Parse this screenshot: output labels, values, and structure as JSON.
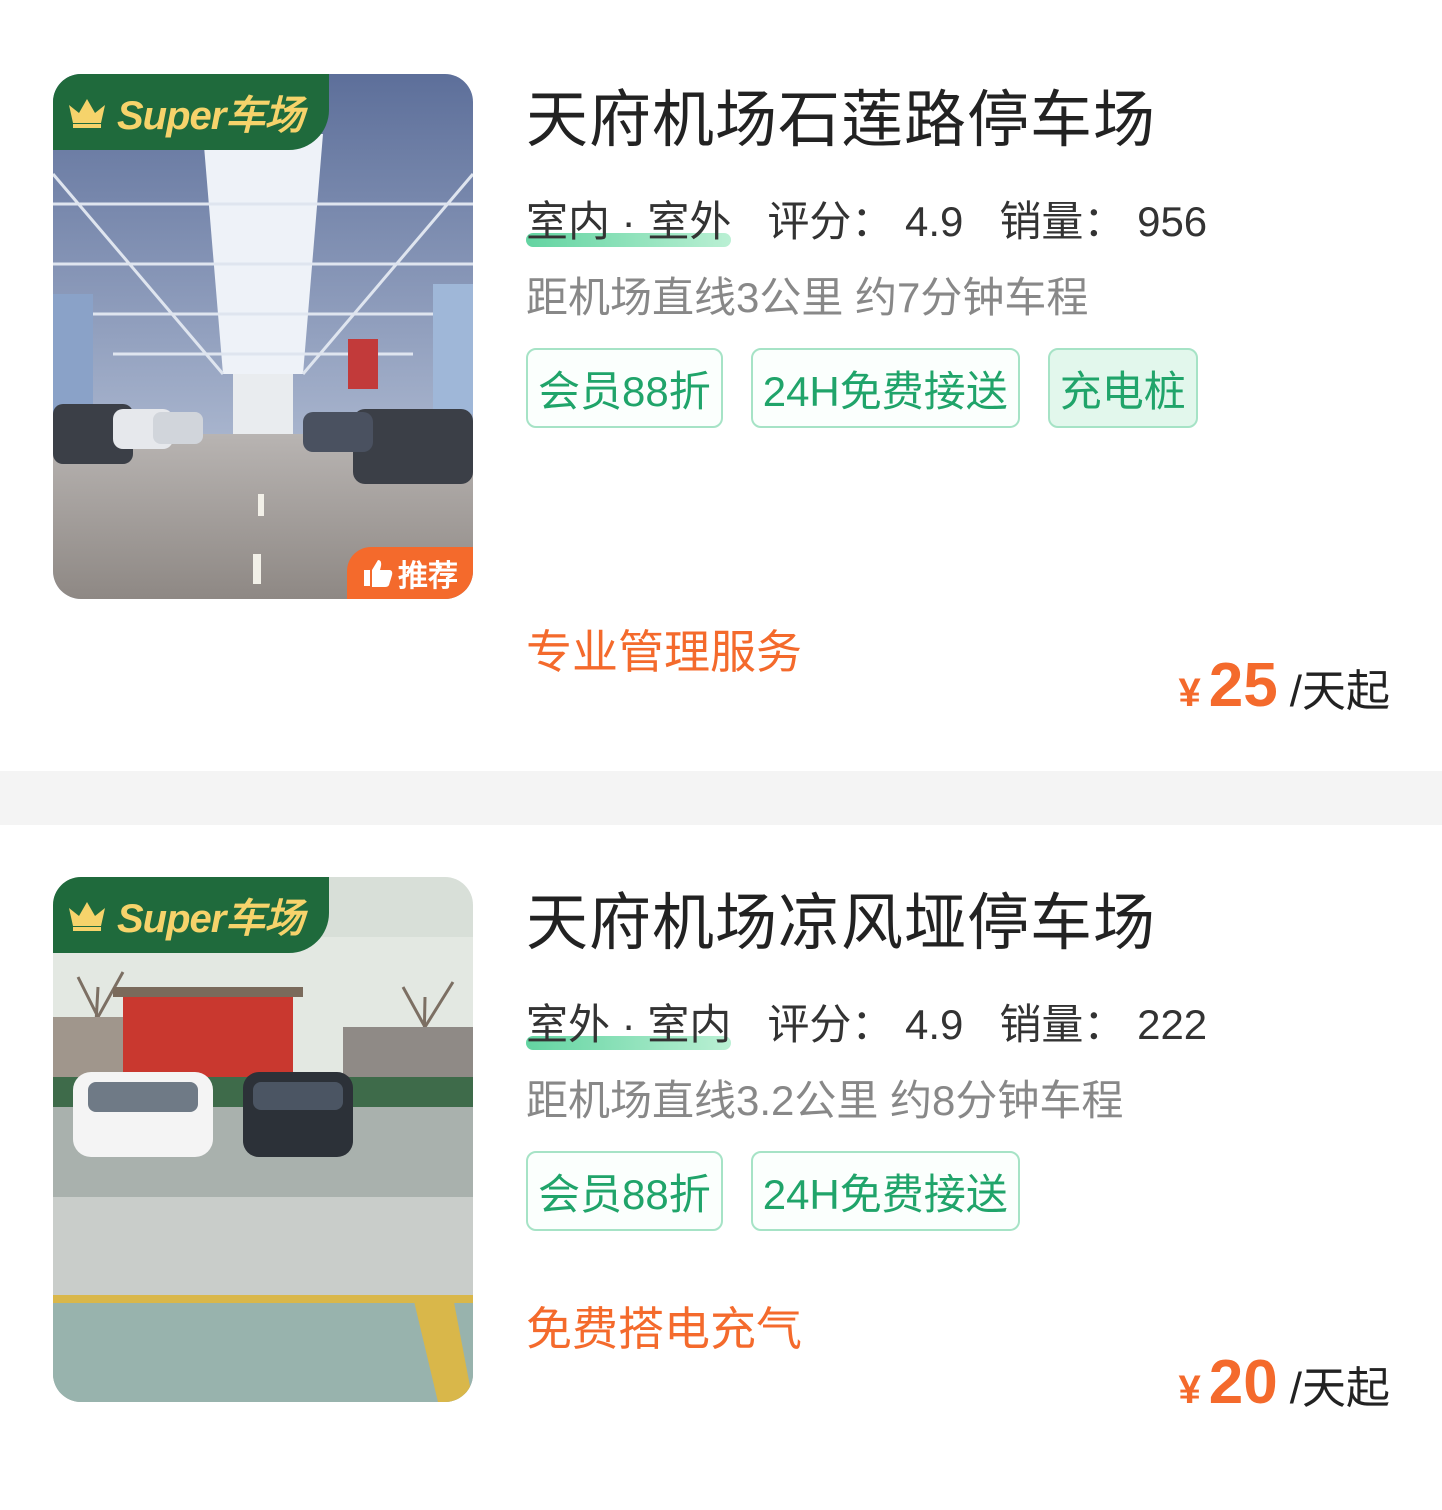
{
  "listings": [
    {
      "badge": "Super车场",
      "recommend": "推荐",
      "title": "天府机场石莲路停车场",
      "parking_type": "室内 · 室外",
      "rating_label": "评分：",
      "rating": "4.9",
      "sales_label": "销量：",
      "sales": "956",
      "distance": "距机场直线3公里 约7分钟车程",
      "tags": [
        "会员88折",
        "24H免费接送",
        "充电桩"
      ],
      "highlight": "专业管理服务",
      "currency": "¥",
      "price": "25",
      "price_unit": "/天起"
    },
    {
      "badge": "Super车场",
      "title": "天府机场凉风垭停车场",
      "parking_type": "室外 · 室内",
      "rating_label": "评分：",
      "rating": "4.9",
      "sales_label": "销量：",
      "sales": "222",
      "distance": "距机场直线3.2公里 约8分钟车程",
      "tags": [
        "会员88折",
        "24H免费接送"
      ],
      "highlight": "免费搭电充气",
      "currency": "¥",
      "price": "20",
      "price_unit": "/天起"
    }
  ],
  "colors": {
    "badge_green": "#1f6a3c",
    "badge_gold": "#f6d36b",
    "tag_green": "#20a46a",
    "accent_orange": "#f46a2c"
  }
}
